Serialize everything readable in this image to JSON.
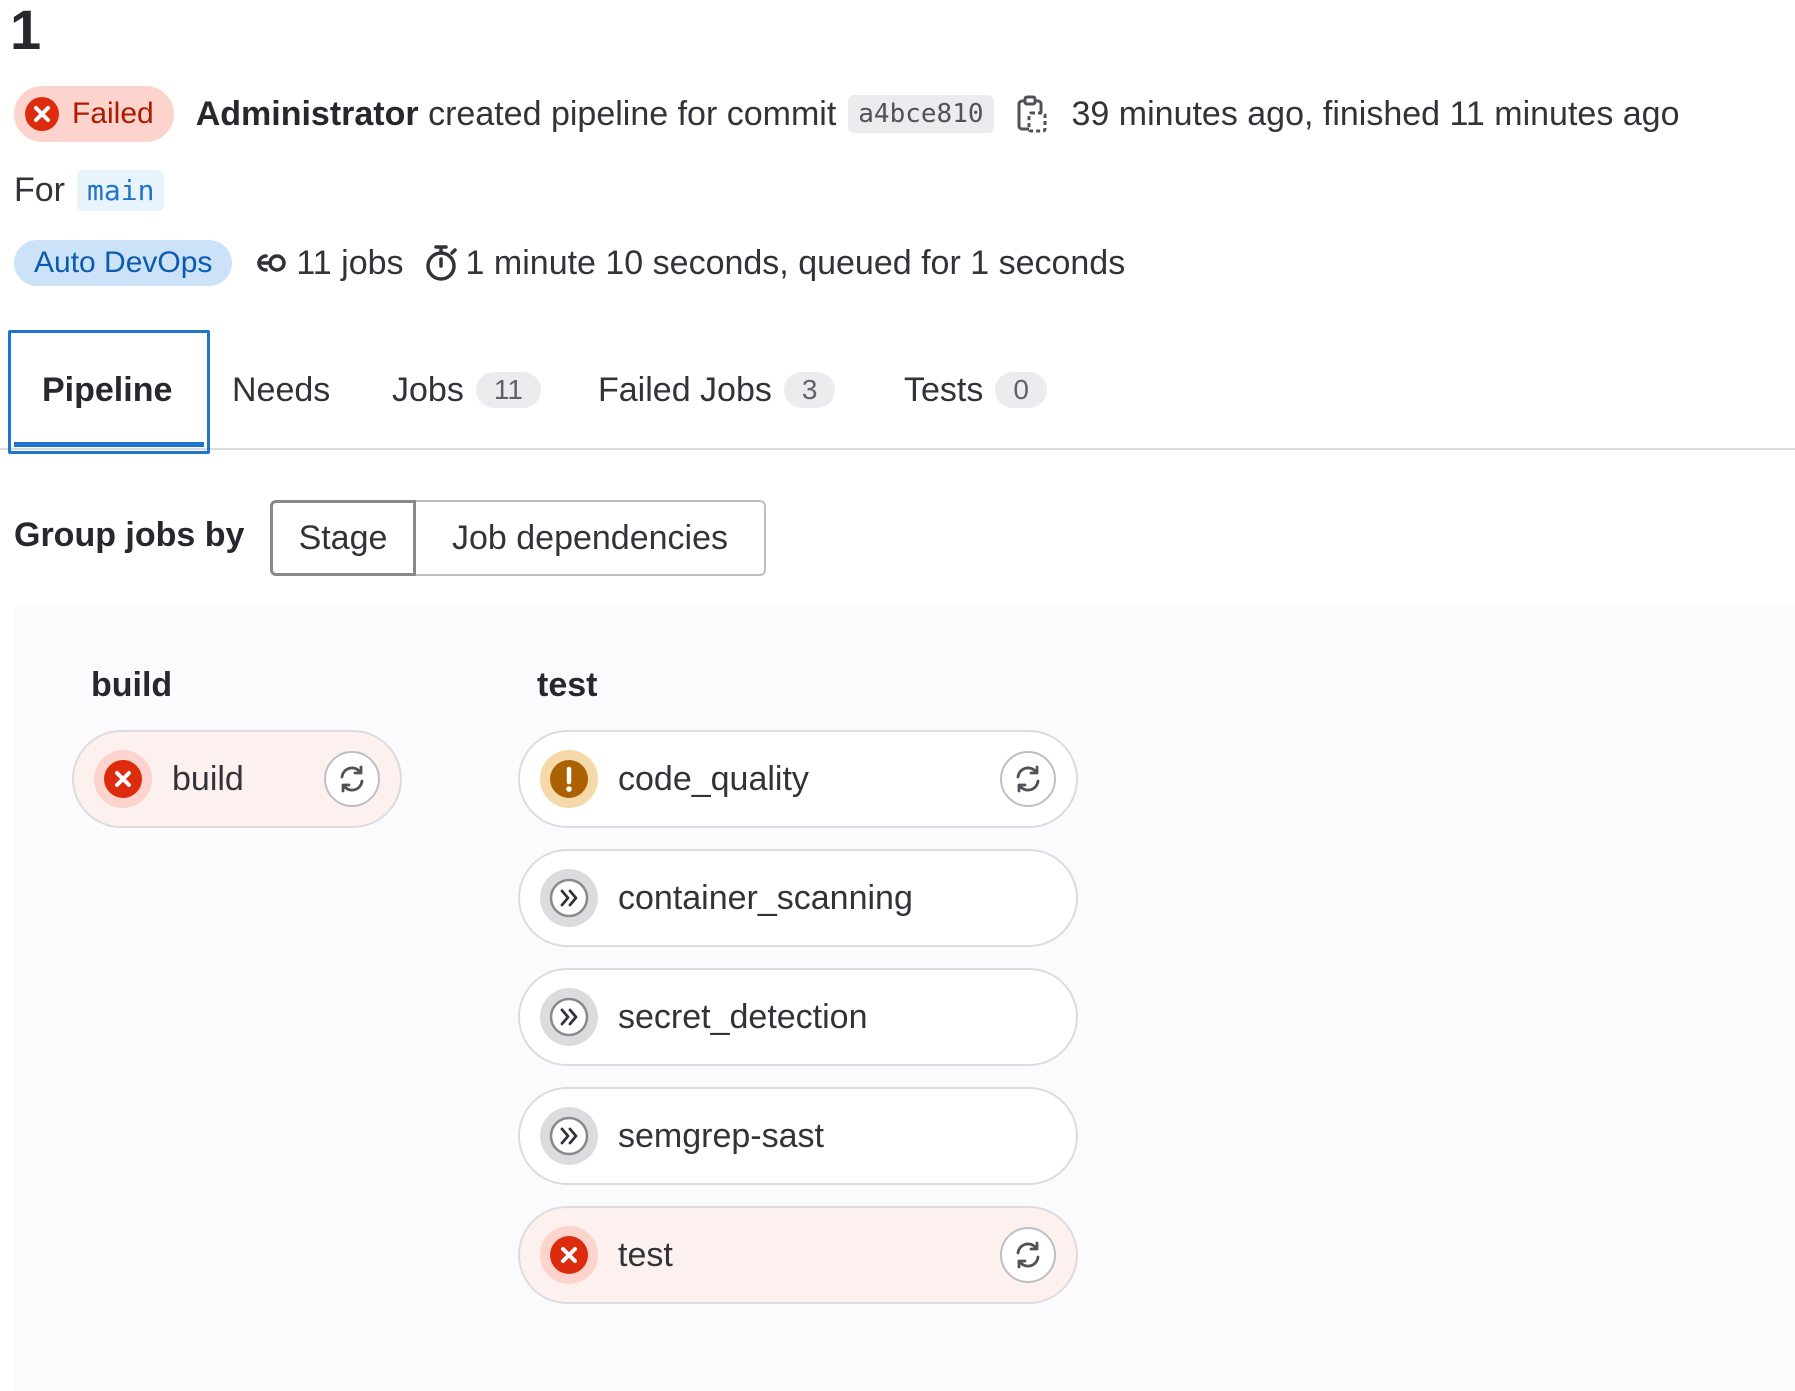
{
  "pipeline": {
    "title": "1",
    "status_label": "Failed",
    "author": "Administrator",
    "action_text": "created pipeline for commit",
    "commit_sha": "a4bce810",
    "times": "39 minutes ago, finished 11 minutes ago",
    "for_label": "For",
    "ref": "main",
    "source_badge": "Auto DevOps",
    "jobs_count": "11 jobs",
    "duration": "1 minute 10 seconds, queued for 1 seconds"
  },
  "tabs": [
    {
      "label": "Pipeline",
      "active": true
    },
    {
      "label": "Needs"
    },
    {
      "label": "Jobs",
      "count": "11"
    },
    {
      "label": "Failed Jobs",
      "count": "3"
    },
    {
      "label": "Tests",
      "count": "0"
    }
  ],
  "grouping": {
    "label": "Group jobs by",
    "options": [
      "Stage",
      "Job dependencies"
    ],
    "selected": "Stage"
  },
  "stages": [
    {
      "name": "build",
      "jobs": [
        {
          "name": "build",
          "status": "failed",
          "retry": true
        }
      ]
    },
    {
      "name": "test",
      "jobs": [
        {
          "name": "code_quality",
          "status": "warning",
          "retry": true
        },
        {
          "name": "container_scanning",
          "status": "manual",
          "retry": false
        },
        {
          "name": "secret_detection",
          "status": "manual",
          "retry": false
        },
        {
          "name": "semgrep-sast",
          "status": "manual",
          "retry": false
        },
        {
          "name": "test",
          "status": "failed",
          "retry": true
        }
      ]
    }
  ],
  "icons": {
    "failed": "status-failed-icon",
    "warning": "status-warning-icon",
    "manual": "status-skipped-icon",
    "retry": "retry-icon",
    "copy": "copy-icon",
    "jobs": "pipeline-jobs-icon",
    "duration": "stopwatch-icon"
  },
  "colors": {
    "failed": "#dd2b0e",
    "warning": "#ab6100",
    "link": "#1f75cb"
  }
}
